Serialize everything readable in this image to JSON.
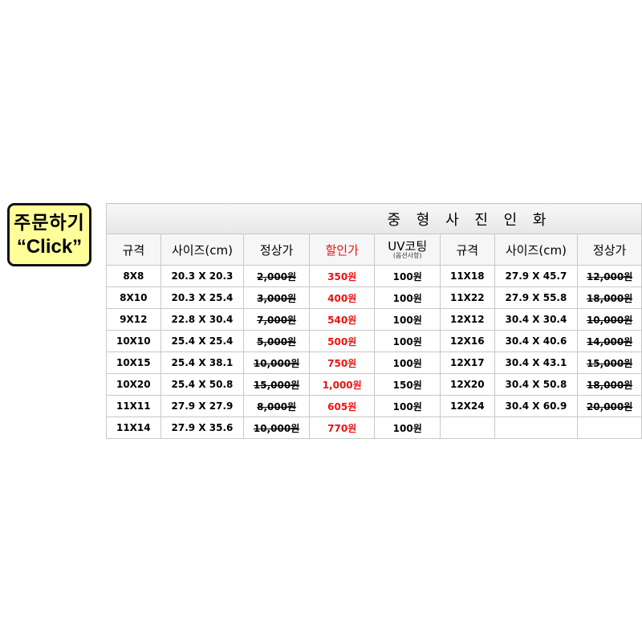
{
  "order_button": {
    "line1": "주문하기",
    "line2": "“Click”"
  },
  "table": {
    "title": "중 형 사 진 인 화",
    "left_headers": {
      "spec": "규격",
      "size": "사이즈(cm)",
      "regular": "정상가",
      "discount": "할인가",
      "uv": "UV코팅",
      "uv_note": "(옵션사항)"
    },
    "right_headers": {
      "spec": "규격",
      "size": "사이즈(cm)",
      "regular": "정상가"
    },
    "left_rows": [
      {
        "spec": "8X8",
        "size": "20.3 X 20.3",
        "regular": "2,000원",
        "discount": "350원",
        "uv": "100원"
      },
      {
        "spec": "8X10",
        "size": "20.3 X 25.4",
        "regular": "3,000원",
        "discount": "400원",
        "uv": "100원"
      },
      {
        "spec": "9X12",
        "size": "22.8 X 30.4",
        "regular": "7,000원",
        "discount": "540원",
        "uv": "100원"
      },
      {
        "spec": "10X10",
        "size": "25.4 X 25.4",
        "regular": "5,000원",
        "discount": "500원",
        "uv": "100원"
      },
      {
        "spec": "10X15",
        "size": "25.4 X 38.1",
        "regular": "10,000원",
        "discount": "750원",
        "uv": "100원"
      },
      {
        "spec": "10X20",
        "size": "25.4 X 50.8",
        "regular": "15,000원",
        "discount": "1,000원",
        "uv": "150원"
      },
      {
        "spec": "11X11",
        "size": "27.9 X 27.9",
        "regular": "8,000원",
        "discount": "605원",
        "uv": "100원"
      },
      {
        "spec": "11X14",
        "size": "27.9 X 35.6",
        "regular": "10,000원",
        "discount": "770원",
        "uv": "100원"
      }
    ],
    "right_rows": [
      {
        "spec": "11X18",
        "size": "27.9 X 45.7",
        "regular": "12,000원"
      },
      {
        "spec": "11X22",
        "size": "27.9 X 55.8",
        "regular": "18,000원"
      },
      {
        "spec": "12X12",
        "size": "30.4 X 30.4",
        "regular": "10,000원"
      },
      {
        "spec": "12X16",
        "size": "30.4 X 40.6",
        "regular": "14,000원"
      },
      {
        "spec": "12X17",
        "size": "30.4 X 43.1",
        "regular": "15,000원"
      },
      {
        "spec": "12X20",
        "size": "30.4 X 50.8",
        "regular": "18,000원"
      },
      {
        "spec": "12X24",
        "size": "30.4 X 60.9",
        "regular": "20,000원"
      },
      {
        "spec": "",
        "size": "",
        "regular": ""
      }
    ]
  },
  "colors": {
    "discount": "#ee1111",
    "button_bg": "#ffff99"
  }
}
